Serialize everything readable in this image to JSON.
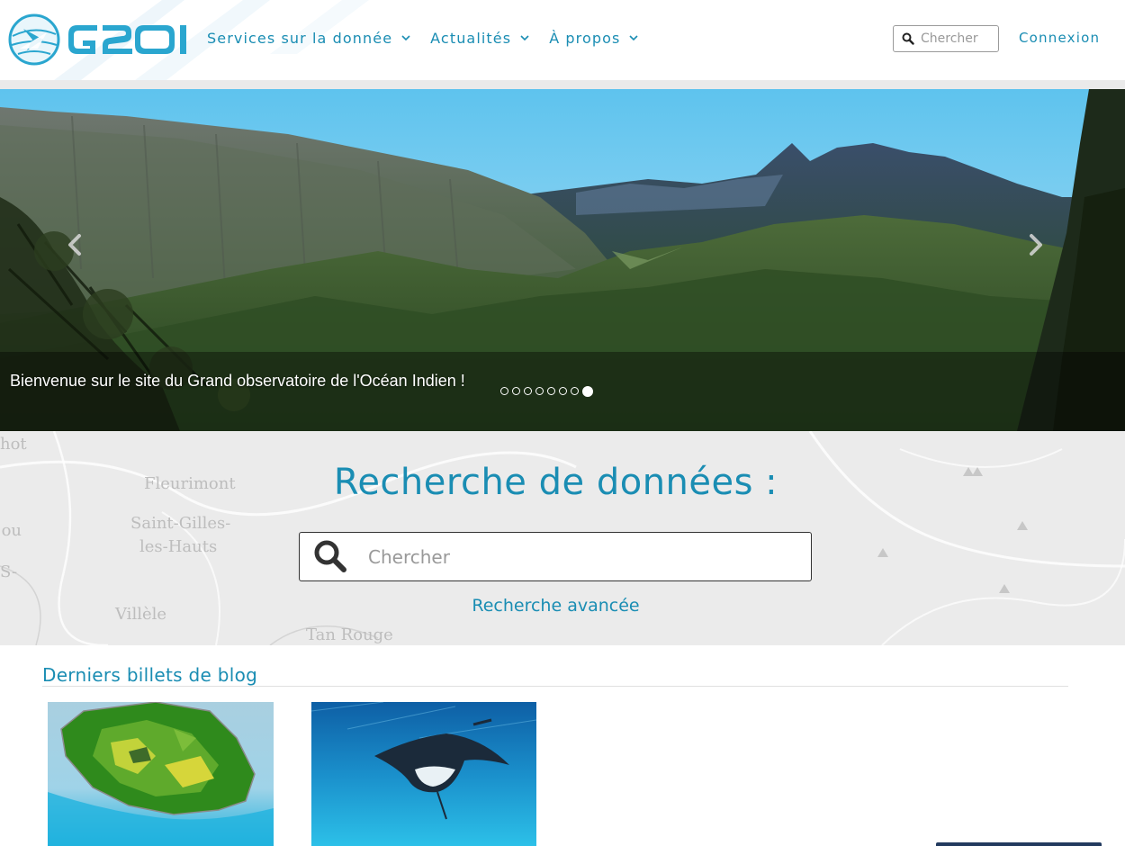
{
  "header": {
    "logo_text": "G2OI",
    "nav": [
      {
        "label": "Services sur la donnée",
        "icon": "chevron-down-icon"
      },
      {
        "label": "Actualités",
        "icon": "chevron-down-icon"
      },
      {
        "label": "À propos",
        "icon": "chevron-down-icon"
      }
    ],
    "search_placeholder": "Chercher",
    "login_label": "Connexion"
  },
  "carousel": {
    "caption": "Bienvenue sur le site du Grand observatoire de l'Océan Indien !",
    "slide_count": 8,
    "active_slide": 8,
    "prev_icon": "chevron-left-icon",
    "next_icon": "chevron-right-icon"
  },
  "data_search": {
    "title": "Recherche de données :",
    "placeholder": "Chercher",
    "advanced_link": "Recherche avancée",
    "map_labels": [
      "Fleurimont",
      "Saint-Gilles-",
      "les-Hauts",
      "Villèle",
      "Tan Rouge",
      "jou",
      "hot",
      "S-"
    ]
  },
  "blog": {
    "title": "Derniers billets de blog",
    "cards": [
      {
        "image": "reunion-island-map-image"
      },
      {
        "image": "manta-ray-image"
      }
    ]
  },
  "colors": {
    "accent": "#1a8db3",
    "header_bg": "#ffffff",
    "section_bg": "#ececec"
  }
}
